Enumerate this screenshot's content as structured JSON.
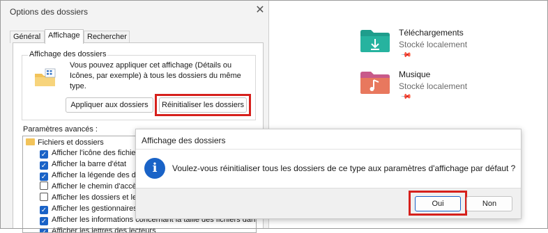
{
  "explorer": {
    "folders": [
      {
        "name": "Téléchargements",
        "status": "Stocké localement",
        "icon": "download-folder-icon",
        "color": "#1f9d8c"
      },
      {
        "name": "Musique",
        "status": "Stocké localement",
        "icon": "music-folder-icon",
        "color": "#e0668a"
      }
    ],
    "pin_glyph": "📌"
  },
  "options_dialog": {
    "title": "Options des dossiers",
    "close_glyph": "✕",
    "tabs": [
      {
        "label": "Général",
        "active": false
      },
      {
        "label": "Affichage",
        "active": true
      },
      {
        "label": "Rechercher",
        "active": false
      }
    ],
    "group": {
      "label": "Affichage des dossiers",
      "description": "Vous pouvez appliquer cet affichage (Détails ou Icônes, par exemple) à tous les dossiers du même type.",
      "apply_button": "Appliquer aux dossiers",
      "reset_button": "Réinitialiser les dossiers"
    },
    "advanced": {
      "label": "Paramètres avancés :",
      "root": "Fichiers et dossiers",
      "items": [
        {
          "label": "Afficher l'icône des fichiers sur les miniatures",
          "checked": true
        },
        {
          "label": "Afficher la barre d'état",
          "checked": true
        },
        {
          "label": "Afficher la légende des dossiers et des éléments du Bureau",
          "checked": true
        },
        {
          "label": "Afficher le chemin d'accès complet dans la barre de titre",
          "checked": false
        },
        {
          "label": "Afficher les dossiers et les lecteurs cachés",
          "checked": false
        },
        {
          "label": "Afficher les gestionnaires d'aperçu",
          "checked": true
        },
        {
          "label": "Afficher les informations concernant la taille des fichiers dans les info-bulles",
          "checked": true
        },
        {
          "label": "Afficher les lettres des lecteurs",
          "checked": true
        }
      ]
    },
    "colors": {
      "checkbox_on": "#1a63c7",
      "highlight": "#d6201c"
    }
  },
  "confirm_dialog": {
    "title": "Affichage des dossiers",
    "info_glyph": "i",
    "message": "Voulez-vous réinitialiser tous les dossiers de ce type aux paramètres d'affichage par défaut ?",
    "yes_button": "Oui",
    "no_button": "Non"
  }
}
